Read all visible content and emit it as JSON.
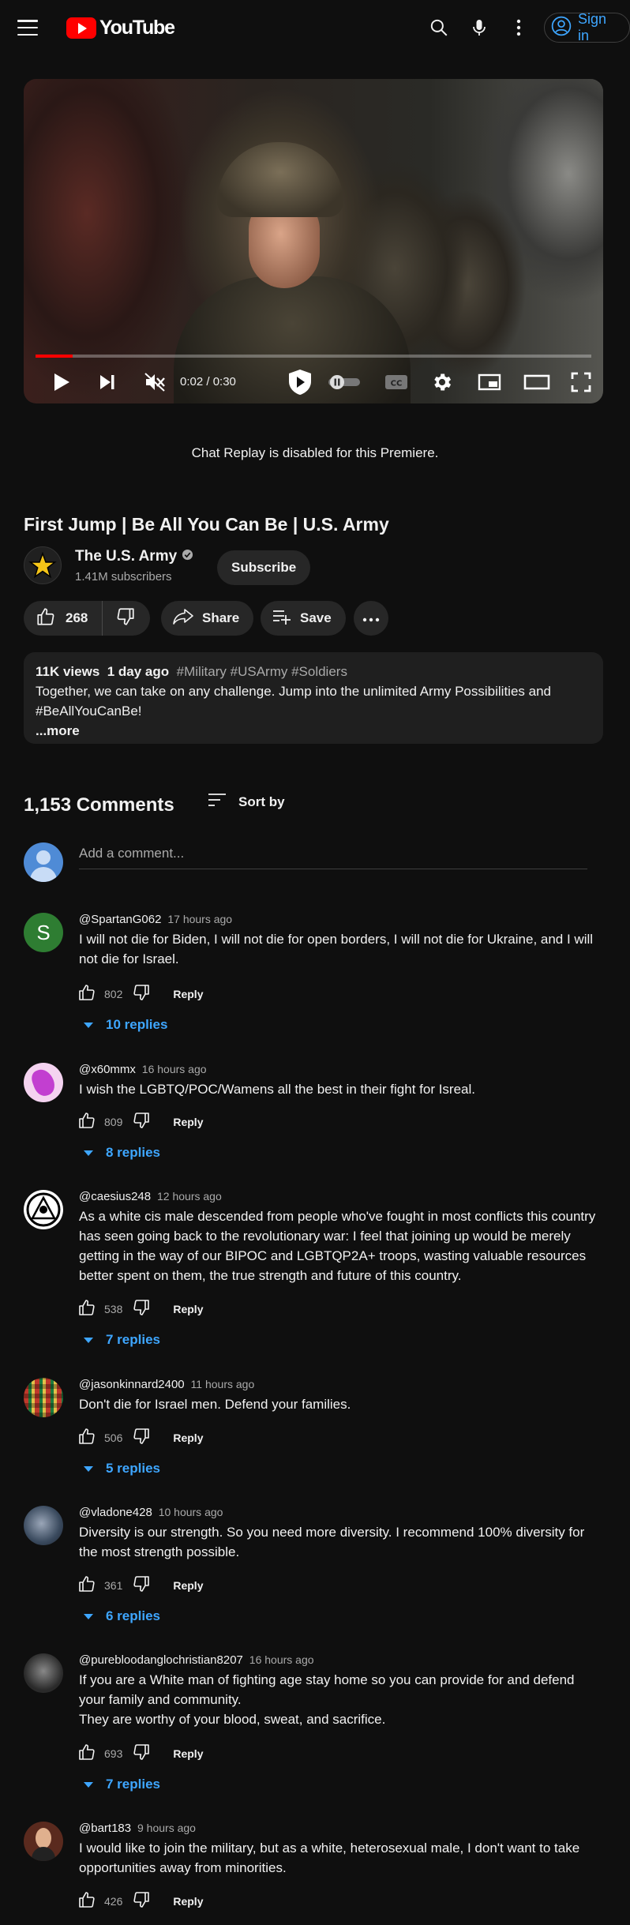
{
  "header": {
    "logo_text": "YouTube",
    "signin_label": "Sign in",
    "icons": [
      "menu-icon",
      "search-icon",
      "mic-icon",
      "more-vert-icon",
      "account-icon"
    ]
  },
  "player": {
    "time": "0:02 / 0:30",
    "progress": 0.067,
    "icons": [
      "play-icon",
      "next-icon",
      "mute-icon",
      "premium-shield-icon",
      "autoplay-toggle",
      "captions-icon",
      "settings-icon",
      "miniplayer-icon",
      "theater-icon",
      "fullscreen-icon"
    ],
    "captions_label": "CC"
  },
  "chat_replay_notice": "Chat Replay is disabled for this Premiere.",
  "video": {
    "title": "First Jump | Be All You Can Be | U.S. Army",
    "channel_name": "The U.S. Army",
    "subscribers": "1.41M subscribers",
    "subscribe_label": "Subscribe",
    "likes": "268",
    "share_label": "Share",
    "save_label": "Save"
  },
  "description": {
    "views": "11K views",
    "age": "1 day ago",
    "tags": "#Military #USArmy #Soldiers",
    "text": "Together, we can take on any challenge. Jump into the unlimited Army Possibilities and #BeAllYouCanBe!",
    "more_label": "...more"
  },
  "comments_header": {
    "count": "1,153 Comments",
    "sort_label": "Sort by",
    "add_placeholder": "Add a comment..."
  },
  "comments": [
    {
      "author": "@SpartanG062",
      "time": "17 hours ago",
      "text": "I will not die for Biden, I will not die for open borders, I will not die for Ukraine, and I will not die for Israel.",
      "likes": "802",
      "reply_label": "Reply",
      "replies": "10 replies",
      "avatar_letter": "S",
      "avatar_color": "#2e7d32"
    },
    {
      "author": "@x60mmx",
      "time": "16 hours ago",
      "text": "I wish the LGBTQ/POC/Wamens all the best in their fight for Isreal.",
      "likes": "809",
      "reply_label": "Reply",
      "replies": "8 replies",
      "avatar_color": "#f4d3f0"
    },
    {
      "author": "@caesius248",
      "time": "12 hours ago",
      "text": "As a white cis male descended from people who've fought in most conflicts this country has seen going back to the revolutionary war: I feel that joining up would be merely getting in the way of our BIPOC and LGBTQP2A+ troops, wasting valuable resources better spent on them, the true strength and future of this country.",
      "likes": "538",
      "reply_label": "Reply",
      "replies": "7 replies",
      "avatar_color": "#ffffff"
    },
    {
      "author": "@jasonkinnard2400",
      "time": "11 hours ago",
      "text": "Don't die for Israel men. Defend your families.",
      "likes": "506",
      "reply_label": "Reply",
      "replies": "5 replies",
      "avatar_color": "#c0392b"
    },
    {
      "author": "@vladone428",
      "time": "10 hours ago",
      "text": "Diversity is our strength. So you need more diversity.  I recommend 100% diversity for the most strength possible.",
      "likes": "361",
      "reply_label": "Reply",
      "replies": "6 replies",
      "avatar_color": "#3a4a5e"
    },
    {
      "author": "@purebloodanglochristian8207",
      "time": "16 hours ago",
      "text": "If you are a White man of fighting age stay home so you can provide for and defend your family and community.\nThey are worthy of your blood, sweat, and sacrifice.",
      "likes": "693",
      "reply_label": "Reply",
      "replies": "7 replies",
      "avatar_color": "#2a2a2a"
    },
    {
      "author": "@bart183",
      "time": "9 hours ago",
      "text": "I would like to join the military, but as a white, heterosexual male, I don't want to take opportunities away from minorities.",
      "likes": "426",
      "reply_label": "Reply",
      "avatar_color": "#5a2a1e"
    }
  ]
}
